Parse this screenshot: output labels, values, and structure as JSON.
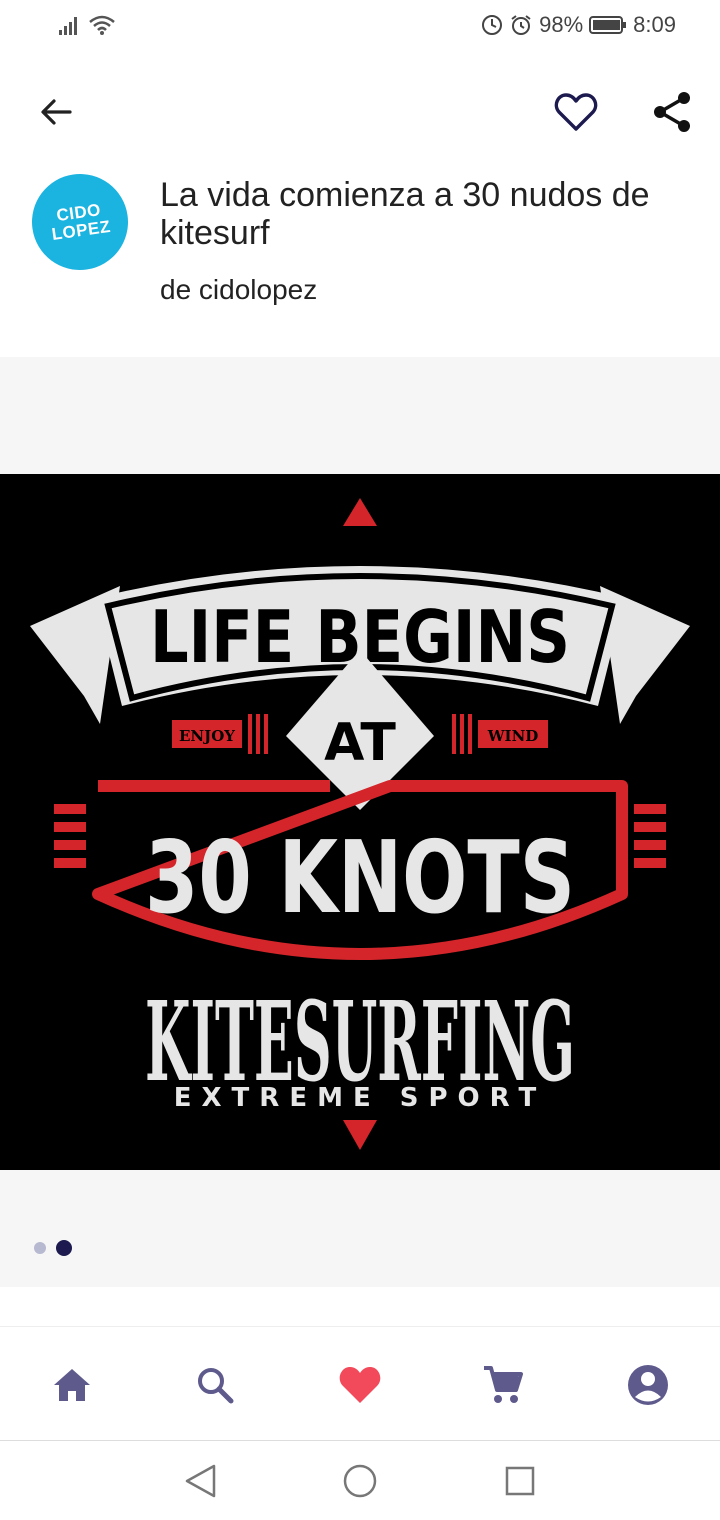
{
  "status": {
    "battery": "98%",
    "time": "8:09"
  },
  "header": {
    "avatar_line1": "CIDO",
    "avatar_line2": "LOPEZ",
    "title": "La vida comienza a 30 nudos de kitesurf",
    "author": "de cidolopez"
  },
  "artwork": {
    "line1": "LIFE BEGINS",
    "at": "AT",
    "enjoy": "ENJOY",
    "wind": "WIND",
    "knots": "30 KNOTS",
    "kitesurfing": "KITESURFING",
    "extreme": "EXTREME SPORT"
  },
  "gallery": {
    "dots": 2,
    "active_index": 1
  },
  "colors": {
    "accent_navy": "#1c1a4e",
    "nav_icon": "#5e5a8c",
    "heart": "#f24a5a",
    "avatar_bg": "#1bb3e0",
    "art_red": "#d3252a"
  },
  "bottom_nav": {
    "items": [
      "home-icon",
      "search-icon",
      "heart-icon",
      "cart-icon",
      "account-icon"
    ]
  }
}
